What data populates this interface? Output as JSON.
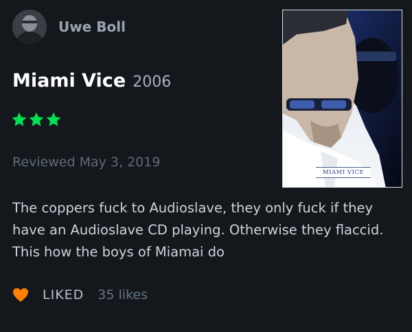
{
  "review": {
    "author": "Uwe Boll",
    "film_title": "Miami Vice",
    "film_year": "2006",
    "rating_stars": 3,
    "rating_max": 5,
    "reviewed_label": "Reviewed May 3, 2019",
    "text": "The coppers fuck to Audioslave, they only fuck if they have an Audioslave CD playing. Otherwise they flaccid. This how the boys of Miamai do",
    "liked_label": "LIKED",
    "likes_label": "35 likes"
  },
  "poster": {
    "caption": "MIAMI VICE"
  },
  "icons": {
    "avatar": "avatar-icon",
    "star": "star-icon",
    "heart": "heart-icon"
  },
  "colors": {
    "background": "#14181c",
    "star": "#00e054",
    "heart": "#ff8000",
    "author": "#9aa4b0",
    "title": "#ffffff",
    "body_text": "#cdd4db"
  }
}
